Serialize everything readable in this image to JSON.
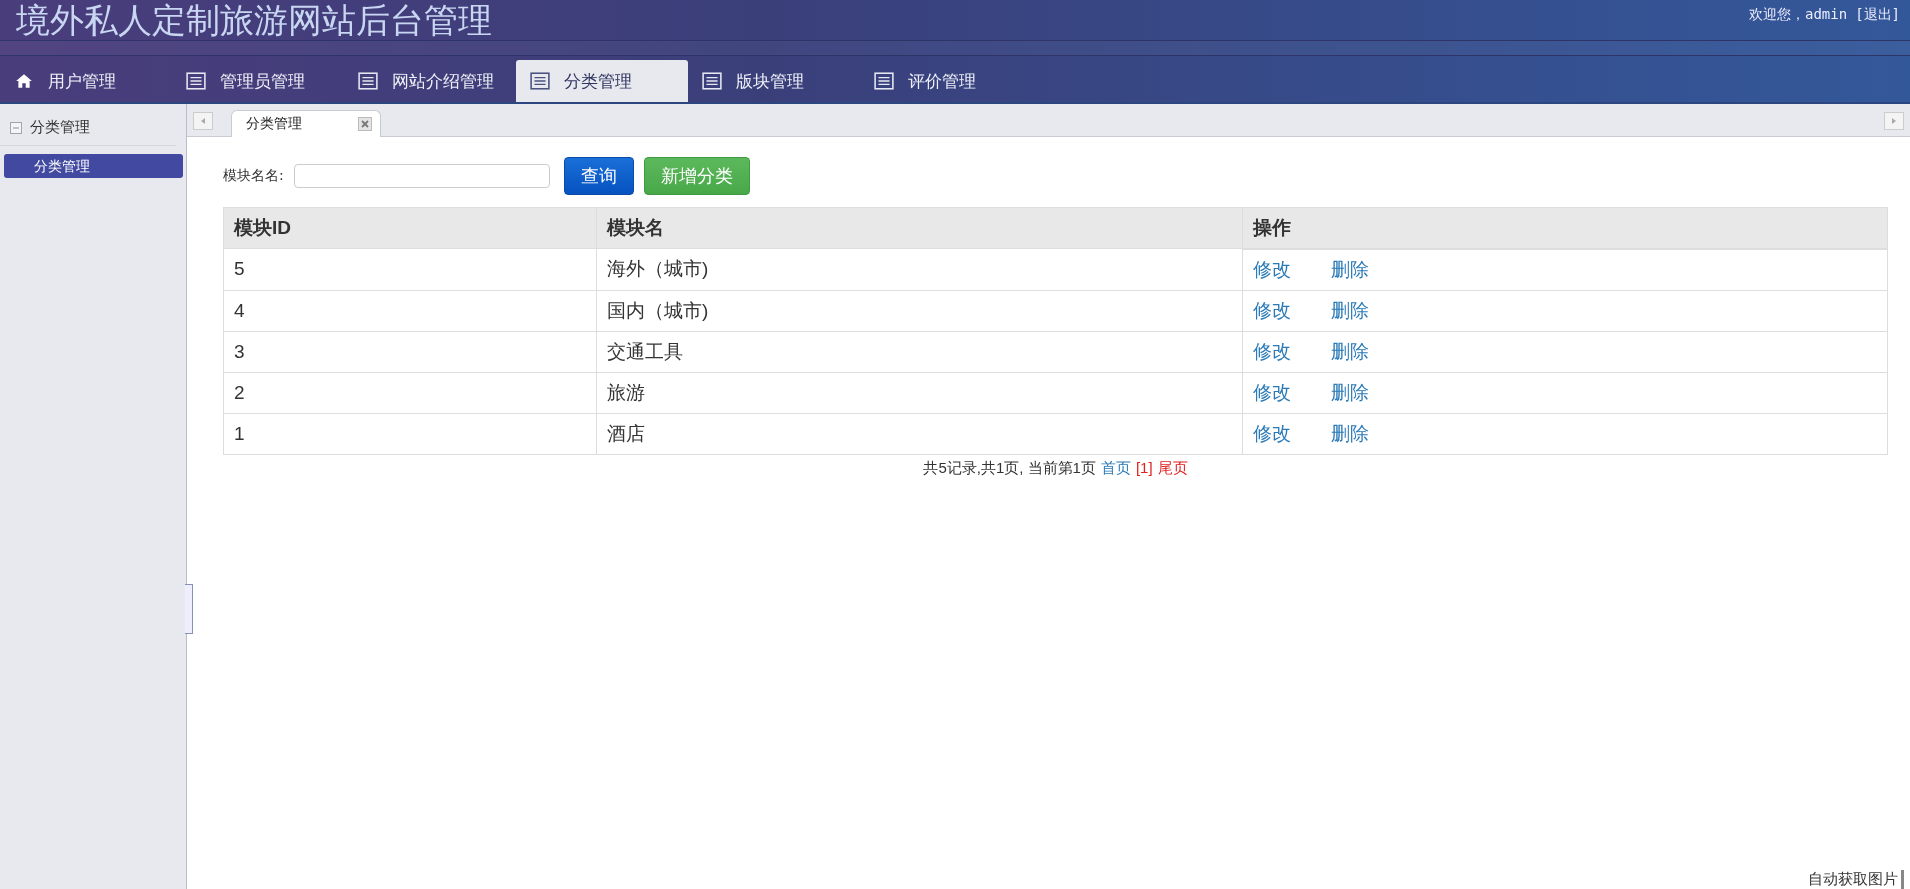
{
  "header": {
    "title": "境外私人定制旅游网站后台管理",
    "welcome": "欢迎您，admin",
    "logout": "[退出]"
  },
  "nav_tabs": [
    {
      "label": "用户管理",
      "kind": "home",
      "selected": false
    },
    {
      "label": "管理员管理",
      "kind": "list",
      "selected": false
    },
    {
      "label": "网站介绍管理",
      "kind": "list",
      "selected": false
    },
    {
      "label": "分类管理",
      "kind": "list",
      "selected": true
    },
    {
      "label": "版块管理",
      "kind": "list",
      "selected": false
    },
    {
      "label": "评价管理",
      "kind": "list",
      "selected": false
    }
  ],
  "sidebar": {
    "section": "分类管理",
    "expanded": true,
    "items": [
      {
        "label": "分类管理",
        "selected": true
      }
    ]
  },
  "page_tabs": [
    {
      "label": "分类管理",
      "selected": true
    }
  ],
  "search": {
    "label": "模块名名:",
    "query_button": "查询",
    "add_button": "新增分类"
  },
  "table": {
    "columns": [
      "模块ID",
      "模块名",
      "操作"
    ],
    "rows": [
      {
        "id": "5",
        "name": "海外（城市)",
        "actions": [
          "修改",
          "删除"
        ]
      },
      {
        "id": "4",
        "name": "国内（城市)",
        "actions": [
          "修改",
          "删除"
        ]
      },
      {
        "id": "3",
        "name": "交通工具",
        "actions": [
          "修改",
          "删除"
        ]
      },
      {
        "id": "2",
        "name": "旅游",
        "actions": [
          "修改",
          "删除"
        ]
      },
      {
        "id": "1",
        "name": "酒店",
        "actions": [
          "修改",
          "删除"
        ]
      }
    ]
  },
  "pagination": {
    "summary": "共5记录,共1页, 当前第1页",
    "first": "首页",
    "current": "[1]",
    "last": "尾页"
  },
  "overlay_label": "自动获取图片"
}
